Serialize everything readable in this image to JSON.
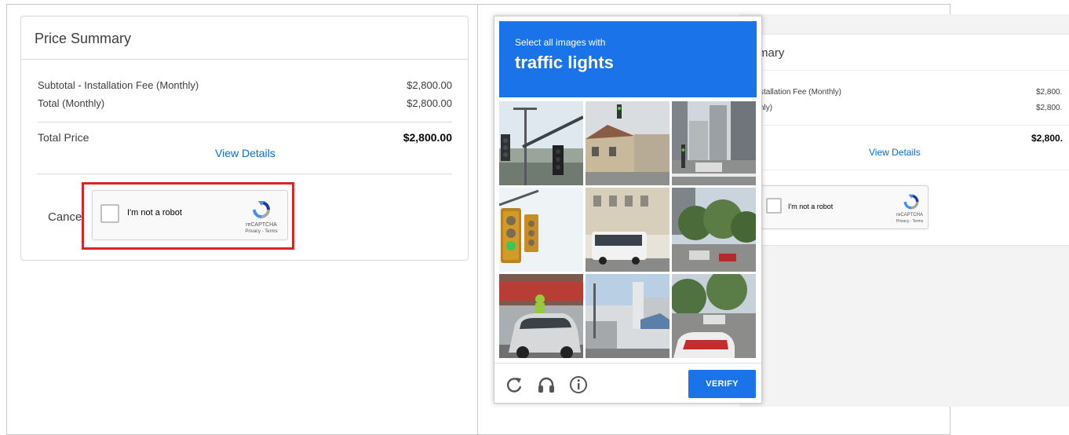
{
  "price_summary": {
    "title": "Price Summary",
    "rows": [
      {
        "label": "Subtotal - Installation Fee (Monthly)",
        "value": "$2,800.00"
      },
      {
        "label": "Total (Monthly)",
        "value": "$2,800.00"
      }
    ],
    "total_label": "Total Price",
    "total_value": "$2,800.00",
    "view_details": "View Details",
    "cancel": "Cancel"
  },
  "recaptcha": {
    "checkbox_label": "I'm not a robot",
    "brand": "reCAPTCHA",
    "terms": "Privacy - Terms"
  },
  "background_summary": {
    "title": "mary",
    "row1_label": "stallation Fee (Monthly)",
    "row2_label": "hly)",
    "row1_value": "$2,800.",
    "row2_value": "$2,800.",
    "total_value": "$2,800.",
    "view_details": "View Details"
  },
  "challenge": {
    "instruction": "Select all images with",
    "target": "traffic lights",
    "tiles": [
      {
        "scene": "traffic light on pole"
      },
      {
        "scene": "street with building"
      },
      {
        "scene": "city crossing"
      },
      {
        "scene": "traffic light close-up"
      },
      {
        "scene": "bus on street"
      },
      {
        "scene": "trees and street"
      },
      {
        "scene": "car and cyclist"
      },
      {
        "scene": "buildings and sky"
      },
      {
        "scene": "car on road"
      }
    ],
    "icons": [
      "reload-icon",
      "audio-icon",
      "info-icon"
    ],
    "verify_label": "VERIFY"
  },
  "colors": {
    "accent_blue": "#1a73e8",
    "link_blue": "#0070d2",
    "highlight_red": "#d9242a"
  }
}
